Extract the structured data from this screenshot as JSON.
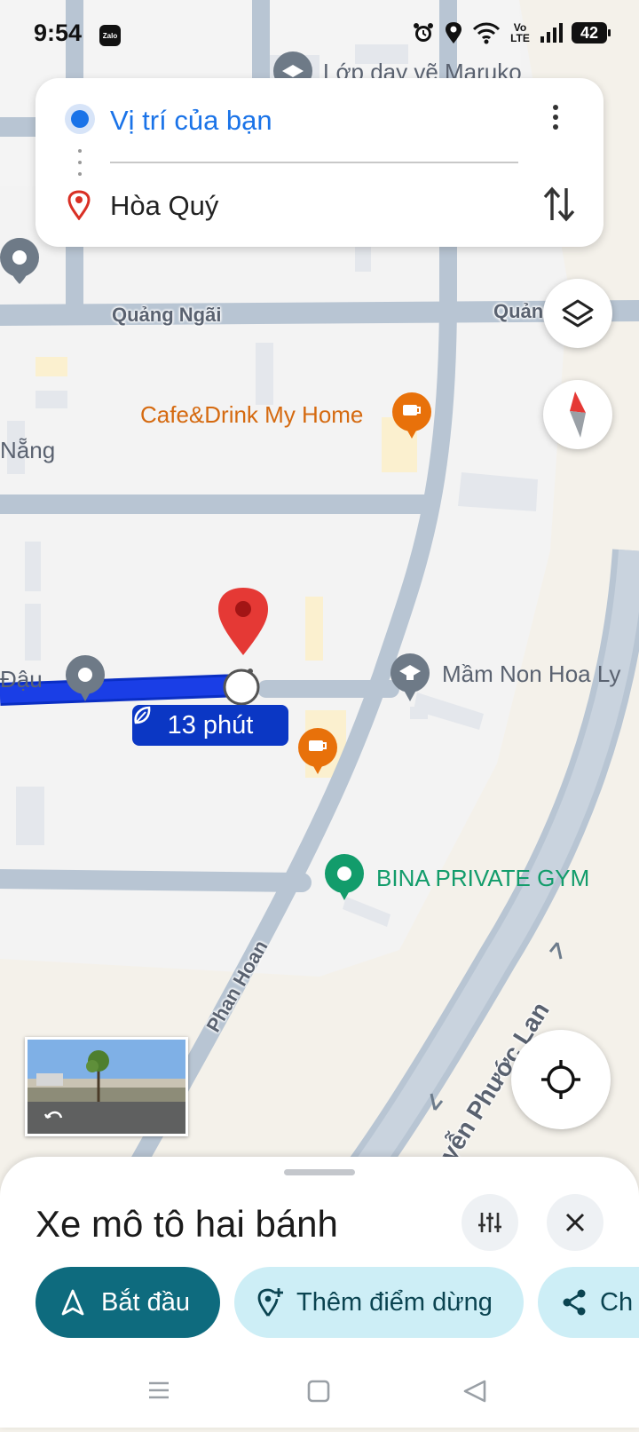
{
  "status_bar": {
    "time": "9:54",
    "app_badge": "Zalo",
    "network": "Vo LTE",
    "battery": "42"
  },
  "route_card": {
    "origin": "Vị trí của bạn",
    "destination": "Hòa Quý"
  },
  "map": {
    "labels": {
      "poi_maruko": "Lớp dạy vẽ Maruko",
      "road_quang_ngai": "Quảng Ngãi",
      "road_quang_ngai_right": "Quảng Ngãi",
      "cafe": "Cafe&Drink My Home",
      "area_nang": "Nẵng",
      "area_dau": "Đậu",
      "school": "Mầm Non Hoa Ly",
      "gym": "BINA PRIVATE GYM",
      "road_phan_hoan": "Phan Hoan",
      "road_phuoc_lan": "uyễn Phước Lan"
    },
    "eta": "13 phút",
    "colors": {
      "route": "#1a3ee6",
      "pin": "#e53935",
      "cafe": "#e8710a",
      "gym": "#129c6b",
      "school": "#6e7a87"
    }
  },
  "sheet": {
    "title": "Xe mô tô hai bánh",
    "start_label": "Bắt đầu",
    "add_stop_label": "Thêm điểm dừng",
    "share_label": "Ch"
  }
}
